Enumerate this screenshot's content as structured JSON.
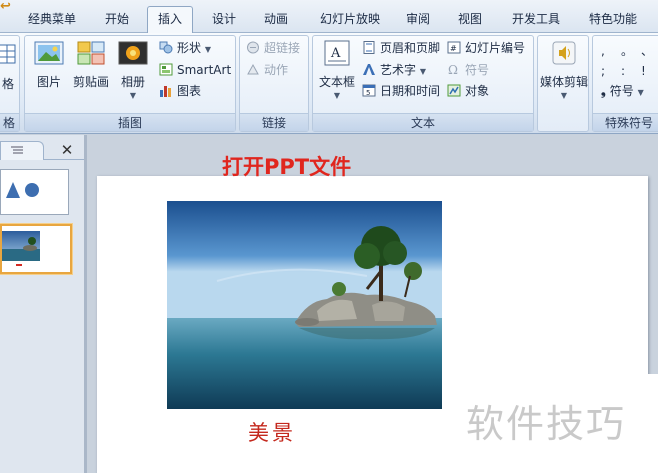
{
  "tabs": [
    {
      "label": "经典菜单",
      "active": false
    },
    {
      "label": "开始",
      "active": false
    },
    {
      "label": "插入",
      "active": true
    },
    {
      "label": "设计",
      "active": false
    },
    {
      "label": "动画",
      "active": false
    },
    {
      "label": "幻灯片放映",
      "active": false
    },
    {
      "label": "审阅",
      "active": false
    },
    {
      "label": "视图",
      "active": false
    },
    {
      "label": "开发工具",
      "active": false
    },
    {
      "label": "特色功能",
      "active": false
    }
  ],
  "ribbon": {
    "table_group": {
      "button": "格",
      "label": "格"
    },
    "illustrations": {
      "label": "插图",
      "picture": "图片",
      "clipart": "剪贴画",
      "album": "相册",
      "shapes": "形状",
      "smartart": "SmartArt",
      "chart": "图表"
    },
    "links": {
      "label": "链接",
      "hyperlink": "超链接",
      "action": "动作"
    },
    "text": {
      "label": "文本",
      "textbox": "文本框",
      "header_footer": "页眉和页脚",
      "wordart": "艺术字",
      "datetime": "日期和时间",
      "slide_number": "幻灯片编号",
      "symbol": "符号",
      "object": "对象"
    },
    "media": {
      "button": "媒体剪辑"
    },
    "special_symbols": {
      "label": "特殊符号",
      "symbol_button": "符号",
      "grid": [
        ",",
        "。",
        "、",
        ";",
        ":",
        "!"
      ]
    }
  },
  "slide": {
    "title": "打开PPT文件",
    "caption": "美景"
  },
  "watermark": "软件技巧",
  "colors": {
    "title_red": "#e0261e",
    "caption_red": "#c4281d",
    "selected_thumb_border": "#e8a640"
  }
}
